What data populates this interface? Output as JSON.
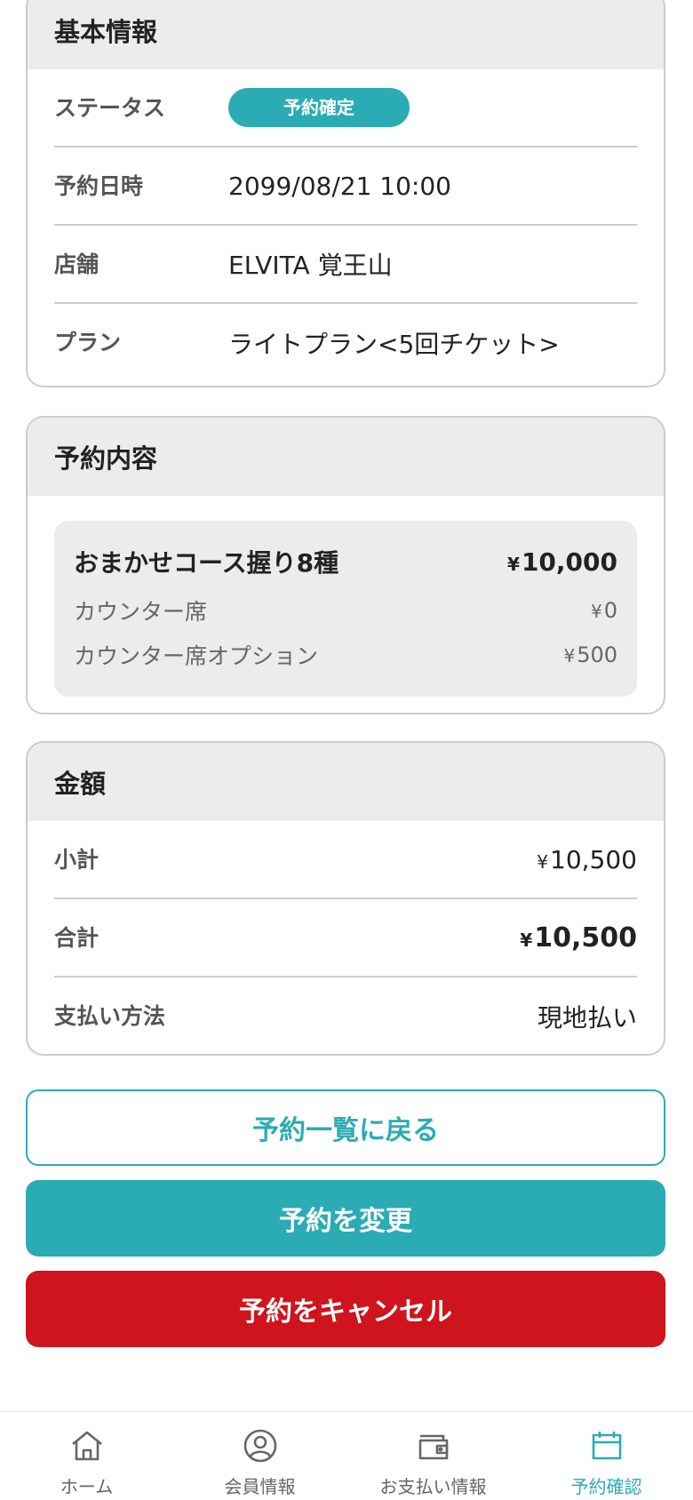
{
  "basic_info": {
    "title": "基本情報",
    "status_label": "ステータス",
    "status_value": "予約確定",
    "datetime_label": "予約日時",
    "datetime_value": "2099/08/21 10:00",
    "store_label": "店舗",
    "store_value": "ELVITA 覚王山",
    "plan_label": "プラン",
    "plan_value": "ライトプラン<5回チケット>"
  },
  "reservation_details": {
    "title": "予約内容",
    "course_name": "おまかせコース握り8種",
    "course_price": "10,000",
    "seat_name": "カウンター席",
    "seat_price": "0",
    "option_name": "カウンター席オプション",
    "option_price": "500",
    "currency": "¥"
  },
  "amount": {
    "title": "金額",
    "subtotal_label": "小計",
    "subtotal_value": "10,500",
    "total_label": "合計",
    "total_value": "10,500",
    "payment_label": "支払い方法",
    "payment_value": "現地払い",
    "currency": "¥"
  },
  "buttons": {
    "back_label": "予約一覧に戻る",
    "change_label": "予約を変更",
    "cancel_label": "予約をキャンセル"
  },
  "tabbar": {
    "items": [
      {
        "label": "ホーム",
        "icon": "home-icon"
      },
      {
        "label": "会員情報",
        "icon": "user-circle-icon"
      },
      {
        "label": "お支払い情報",
        "icon": "wallet-icon"
      },
      {
        "label": "予約確認",
        "icon": "calendar-icon"
      }
    ],
    "active_index": 3
  },
  "colors": {
    "accent": "#2bacb4",
    "danger": "#cf141d",
    "header_bg": "#ececec"
  }
}
